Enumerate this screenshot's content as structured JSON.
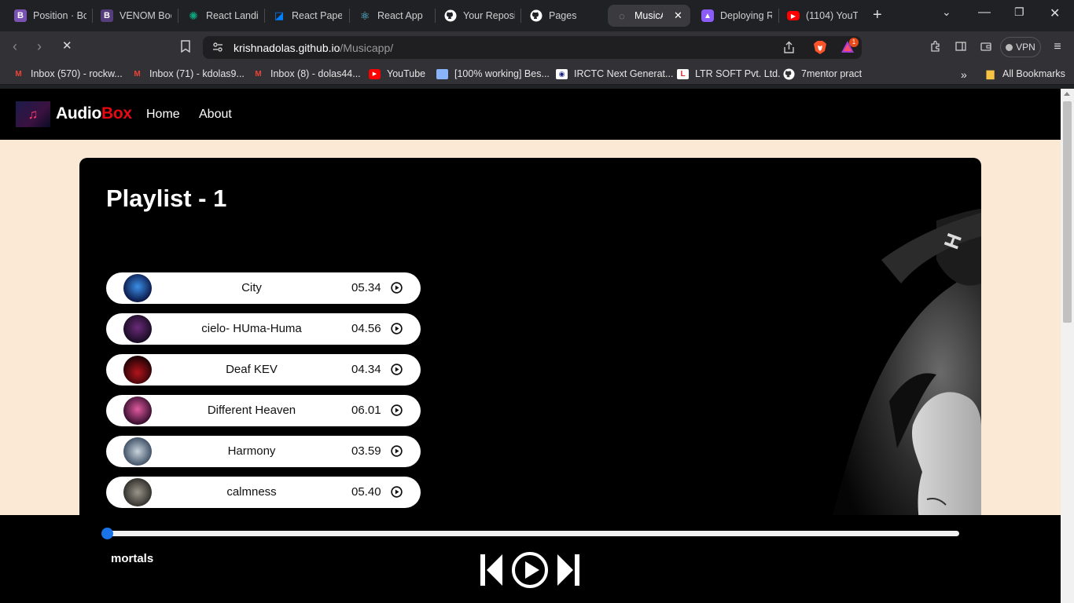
{
  "browser": {
    "tabs": [
      {
        "title": "Position · Bo",
        "icon": "bootstrap-icon",
        "color": "#7952b3"
      },
      {
        "title": "VENOM Boo",
        "icon": "bootstrap-icon",
        "color": "#563d7c"
      },
      {
        "title": "React Landin",
        "icon": "chatgpt-icon",
        "color": "#10a37f"
      },
      {
        "title": "React Paper",
        "icon": "mui-icon",
        "color": "#007fff"
      },
      {
        "title": "React App",
        "icon": "react-icon",
        "color": "#61dafb"
      },
      {
        "title": "Your Reposi",
        "icon": "github-icon",
        "color": "#ffffff"
      },
      {
        "title": "Pages",
        "icon": "github-icon",
        "color": "#ffffff"
      },
      {
        "title": "MusicA",
        "icon": "loading-icon",
        "color": "#aaaaaa"
      },
      {
        "title": "Deploying R",
        "icon": "deploy-icon",
        "color": "#8b5cf6"
      },
      {
        "title": "(1104) YouT",
        "icon": "youtube-icon",
        "color": "#ff0000"
      }
    ],
    "url_host": "krishnadolas.github.io",
    "url_path": "/Musicapp/",
    "notification_count": "1",
    "vpn_label": "VPN",
    "bookmarks": [
      {
        "label": "Inbox (570) - rockw...",
        "icon": "gmail-icon"
      },
      {
        "label": "Inbox (71) - kdolas9...",
        "icon": "gmail-icon"
      },
      {
        "label": "Inbox (8) - dolas44...",
        "icon": "gmail-icon"
      },
      {
        "label": "YouTube",
        "icon": "youtube-icon"
      },
      {
        "label": "[100% working] Bes...",
        "icon": "page-icon"
      },
      {
        "label": "IRCTC Next Generat...",
        "icon": "irctc-icon"
      },
      {
        "label": "LTR SOFT Pvt. Ltd.",
        "icon": "ltr-icon"
      },
      {
        "label": "7mentor pract",
        "icon": "github-icon"
      }
    ],
    "all_bookmarks": "All Bookmarks"
  },
  "site": {
    "brand_main": "Audio",
    "brand_accent": "Box",
    "nav": [
      "Home",
      "About"
    ]
  },
  "playlist": {
    "title": "Playlist - 1",
    "songs": [
      {
        "name": "City",
        "duration": "05.34",
        "thumb_color": "#1a4fb0"
      },
      {
        "name": "cielo- HUma-Huma",
        "duration": "04.56",
        "thumb_color": "#6b2b7a"
      },
      {
        "name": "Deaf KEV",
        "duration": "04.34",
        "thumb_color": "#8b0c12"
      },
      {
        "name": "Different Heaven",
        "duration": "06.01",
        "thumb_color": "#c23a7a"
      },
      {
        "name": "Harmony",
        "duration": "03.59",
        "thumb_color": "#7a95a8"
      },
      {
        "name": "calmness",
        "duration": "05.40",
        "thumb_color": "#6e6a62"
      }
    ]
  },
  "player": {
    "now_playing": "mortals",
    "progress": 0
  },
  "colors": {
    "page_bg": "#fbe9d5",
    "brand_accent": "#e50914",
    "progress_knob": "#1a73e8"
  }
}
